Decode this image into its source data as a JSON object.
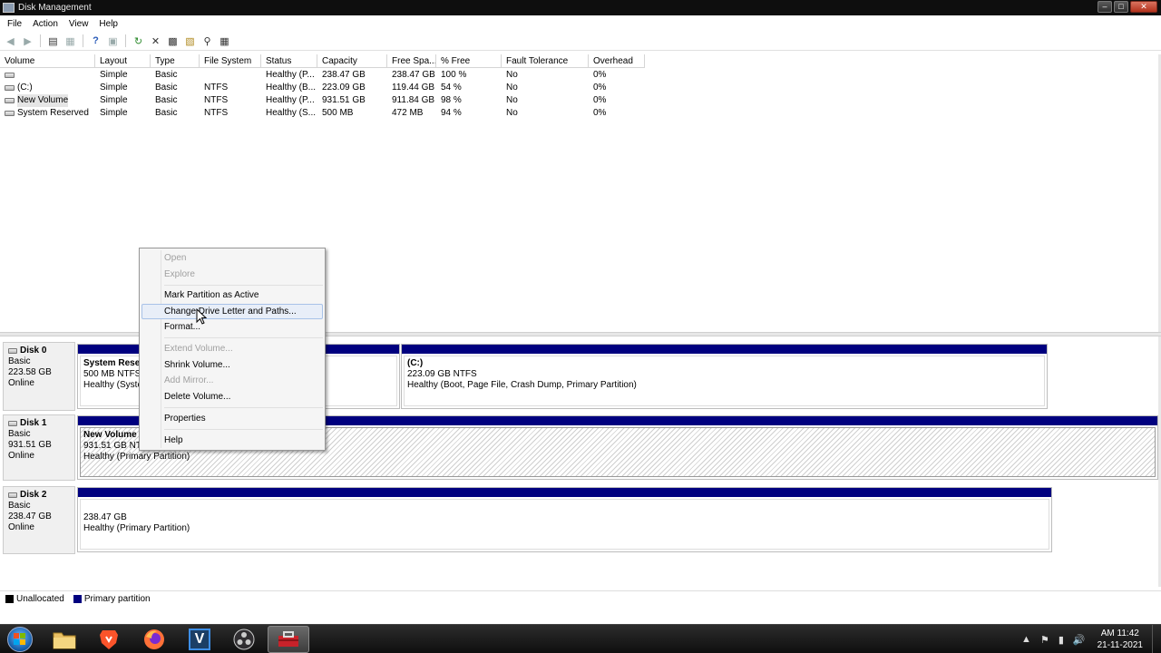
{
  "window": {
    "title": "Disk Management",
    "minimize": "0",
    "maximize": "1",
    "close": "x"
  },
  "menubar": [
    "File",
    "Action",
    "View",
    "Help"
  ],
  "toolbar": [
    "back-icon",
    "forward-icon",
    "console-tree-icon",
    "help-icon",
    "refresh-icon",
    "delete-icon",
    "properties-icon",
    "open-icon",
    "explore-icon",
    "rescan-icon"
  ],
  "volume_list": {
    "columns": [
      "Volume",
      "Layout",
      "Type",
      "File System",
      "Status",
      "Capacity",
      "Free Spa...",
      "% Free",
      "Fault Tolerance",
      "Overhead"
    ],
    "rows": [
      [
        "",
        "Simple",
        "Basic",
        "",
        "Healthy (P...",
        "238.47 GB",
        "238.47 GB",
        "100 %",
        "No",
        "0%"
      ],
      [
        "(C:)",
        "Simple",
        "Basic",
        "NTFS",
        "Healthy (B...",
        "223.09 GB",
        "119.44 GB",
        "54 %",
        "No",
        "0%"
      ],
      [
        "New Volume",
        "Simple",
        "Basic",
        "NTFS",
        "Healthy (P...",
        "931.51 GB",
        "911.84 GB",
        "98 %",
        "No",
        "0%"
      ],
      [
        "System Reserved",
        "Simple",
        "Basic",
        "NTFS",
        "Healthy (S...",
        "500 MB",
        "472 MB",
        "94 %",
        "No",
        "0%"
      ]
    ]
  },
  "disks": [
    {
      "name": "Disk 0",
      "type": "Basic",
      "size": "223.58 GB",
      "status": "Online",
      "partitions": [
        {
          "name": "System Reser",
          "size": "500 MB NTFS",
          "health": "Healthy (Syster"
        },
        {
          "name": "(C:)",
          "size": "223.09 GB NTFS",
          "health": "Healthy (Boot, Page File, Crash Dump, Primary Partition)"
        }
      ]
    },
    {
      "name": "Disk 1",
      "type": "Basic",
      "size": "931.51 GB",
      "status": "Online",
      "partitions": [
        {
          "name": "New Volume",
          "size": "931.51 GB NTF",
          "health": "Healthy (Primary Partition)"
        }
      ]
    },
    {
      "name": "Disk 2",
      "type": "Basic",
      "size": "238.47 GB",
      "status": "Online",
      "partitions": [
        {
          "name": "",
          "size": "238.47 GB",
          "health": "Healthy (Primary Partition)"
        }
      ]
    }
  ],
  "legend": [
    {
      "label": "Unallocated",
      "color": "#000000"
    },
    {
      "label": "Primary partition",
      "color": "#00007f"
    }
  ],
  "context_menu": {
    "items": [
      {
        "label": "Open",
        "enabled": false
      },
      {
        "label": "Explore",
        "enabled": false
      },
      {
        "label": "Mark Partition as Active",
        "enabled": true
      },
      {
        "label": "Change Drive Letter and Paths...",
        "enabled": true,
        "highlighted": true
      },
      {
        "label": "Format...",
        "enabled": true
      },
      {
        "label": "Extend Volume...",
        "enabled": false
      },
      {
        "label": "Shrink Volume...",
        "enabled": true
      },
      {
        "label": "Add Mirror...",
        "enabled": false
      },
      {
        "label": "Delete Volume...",
        "enabled": true
      },
      {
        "label": "Properties",
        "enabled": true
      },
      {
        "label": "Help",
        "enabled": true
      }
    ]
  },
  "taskbar": {
    "apps": [
      "windows-explorer-icon",
      "brave-icon",
      "firefox-icon",
      "v-app-icon",
      "obs-icon",
      "toolbox-icon"
    ],
    "clock_time": "AM 11:42",
    "clock_date": "21-11-2021"
  },
  "colors": {
    "primary_partition": "#00007f",
    "titlebar": "#0e0e0e",
    "taskbar": "#1c1c1c"
  }
}
